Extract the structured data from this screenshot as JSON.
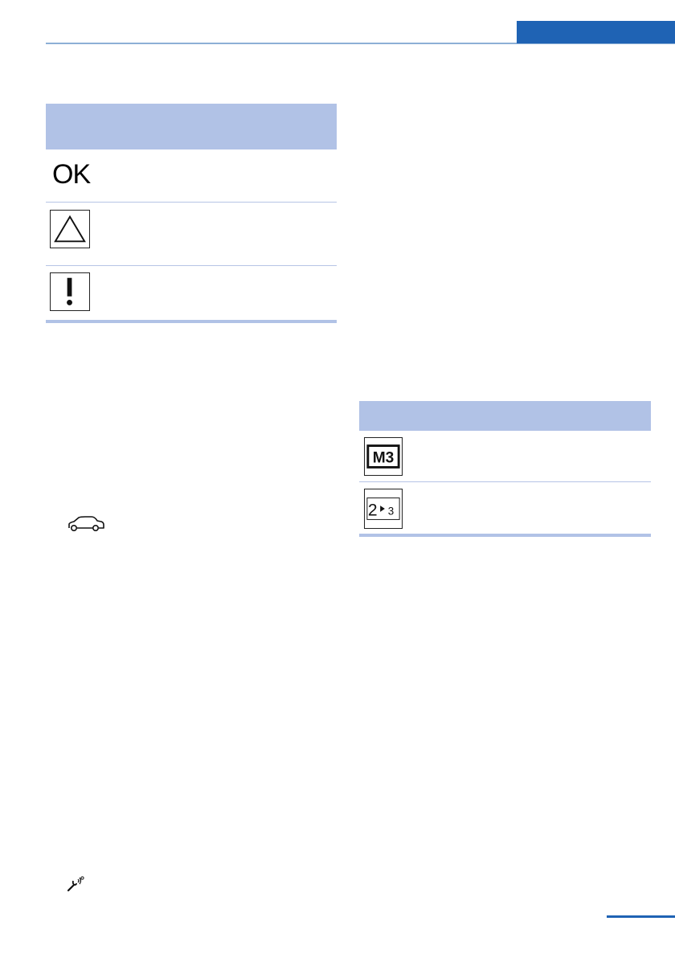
{
  "status_table": {
    "ok_label": "OK",
    "icons": [
      "warning-triangle-icon",
      "exclamation-icon"
    ]
  },
  "gear_table": {
    "icons": [
      "gear-m3-icon",
      "upshift-2-to-3-icon"
    ],
    "m3_label": "M3",
    "shift_from": "2",
    "shift_to": "3"
  },
  "margin_icons": [
    "car-icon",
    "wrench-icon"
  ],
  "colors": {
    "accent_blue": "#1f63b4",
    "table_header": "#b1c2e6",
    "rule_light": "#8db0d6"
  }
}
